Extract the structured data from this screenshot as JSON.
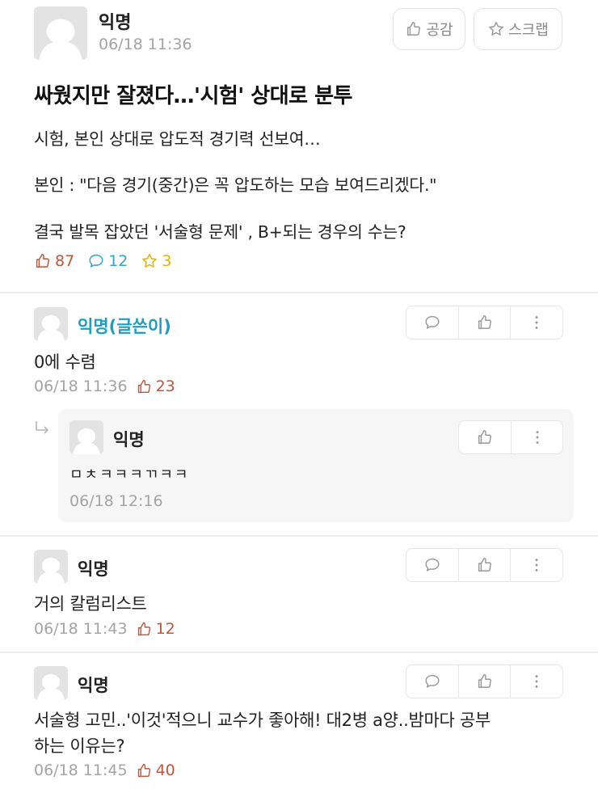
{
  "post": {
    "author": "익명",
    "time": "06/18 11:36",
    "buttons": {
      "like_label": "공감",
      "scrap_label": "스크랩"
    },
    "title": "싸웠지만 잘졌다…'시험' 상대로 분투",
    "body": [
      "시험, 본인 상대로 압도적 경기력 선보여…",
      "본인 : \"다음 경기(중간)은 꼭 압도하는 모습 보여드리겠다.\"",
      "결국 발목 잡았던 '서술형 문제' , B+되는 경우의 수는?"
    ],
    "stats": {
      "likes": "87",
      "comments": "12",
      "scraps": "3"
    }
  },
  "comments": [
    {
      "author": "익명(글쓴이)",
      "text": "0에 수렴",
      "time": "06/18 11:36",
      "votes": "23"
    },
    {
      "author": "익명",
      "text": "ㅁㅊㅋㅋㅋㄲㅋㅋ",
      "time": "06/18 12:16"
    },
    {
      "author": "익명",
      "text": "거의 칼럼리스트",
      "time": "06/18 11:43",
      "votes": "12"
    },
    {
      "author": "익명",
      "text_lines": [
        "서술형 고민..'이것'적으니 교수가 좋아해! 대2병 a양..밤마다 공부",
        "하는 이유는?"
      ],
      "time": "06/18 11:45",
      "votes": "40"
    }
  ],
  "icons": {
    "avatar": "avatar-icon",
    "like": "thumbs-up-icon",
    "comment": "speech-bubble-icon",
    "scrap": "star-icon",
    "more": "more-vertical-icon",
    "reply": "reply-arrow-icon"
  },
  "colors": {
    "like": "#c0563b",
    "comment": "#2ea6c7",
    "scrap": "#e2b400",
    "author_highlight": "#1e9ec2",
    "meta_gray": "#a4a4a4"
  }
}
